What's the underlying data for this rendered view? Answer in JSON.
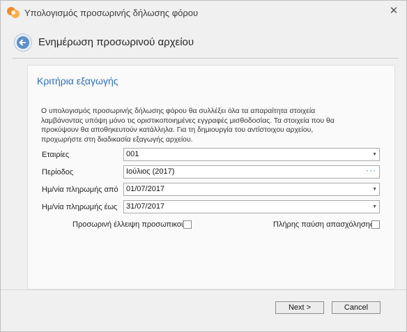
{
  "window": {
    "title": "Υπολογισμός προσωρινής δήλωσης φόρου",
    "close_glyph": "✕"
  },
  "header": {
    "title": "Ενημέρωση προσωρινού αρχείου"
  },
  "panel": {
    "section_title": "Κριτήρια εξαγωγής",
    "description_lines": [
      "Ο υπολογισμός προσωρινής δήλωσης φόρου θα συλλέξει όλα τα απαραίτητα στοιχεία",
      "λαμβάνοντας υπόψη μόνο τις οριστικοποιημένες εγγραφές μισθοδοσίας. Τα στοιχεία που θα",
      "προκύψουν θα αποθηκευτούν κατάλληλα. Για τη δημιουργία του αντίστοιχου αρχείου,",
      "προχωρήστε στη διαδικασία εξαγωγής αρχείου."
    ],
    "fields": {
      "companies": {
        "label": "Εταιρίες",
        "value": "001"
      },
      "period": {
        "label": "Περίοδος",
        "value": "Ιούλιος (2017)"
      },
      "payment_from": {
        "label": "Ημ/νία πληρωμής από",
        "value": "01/07/2017"
      },
      "payment_to": {
        "label": "Ημ/νία πληρωμής έως",
        "value": "31/07/2017"
      }
    },
    "checkboxes": {
      "temp_staff_shortage": {
        "label": "Προσωρινή έλλειψη προσωπικού",
        "checked": false
      },
      "full_employment_termination": {
        "label": "Πλήρης παύση απασχόλησης",
        "checked": false
      }
    }
  },
  "footer": {
    "next_label": "Next >",
    "cancel_label": "Cancel"
  },
  "colors": {
    "accent": "#2a6ebb",
    "window_bg": "#f0f0f0",
    "panel_bg": "#fafafa"
  },
  "icons": {
    "app": "app-logo-icon",
    "back": "back-arrow-icon",
    "close": "close-icon",
    "dropdown": "chevron-down-icon",
    "ellipsis": "ellipsis-icon"
  }
}
